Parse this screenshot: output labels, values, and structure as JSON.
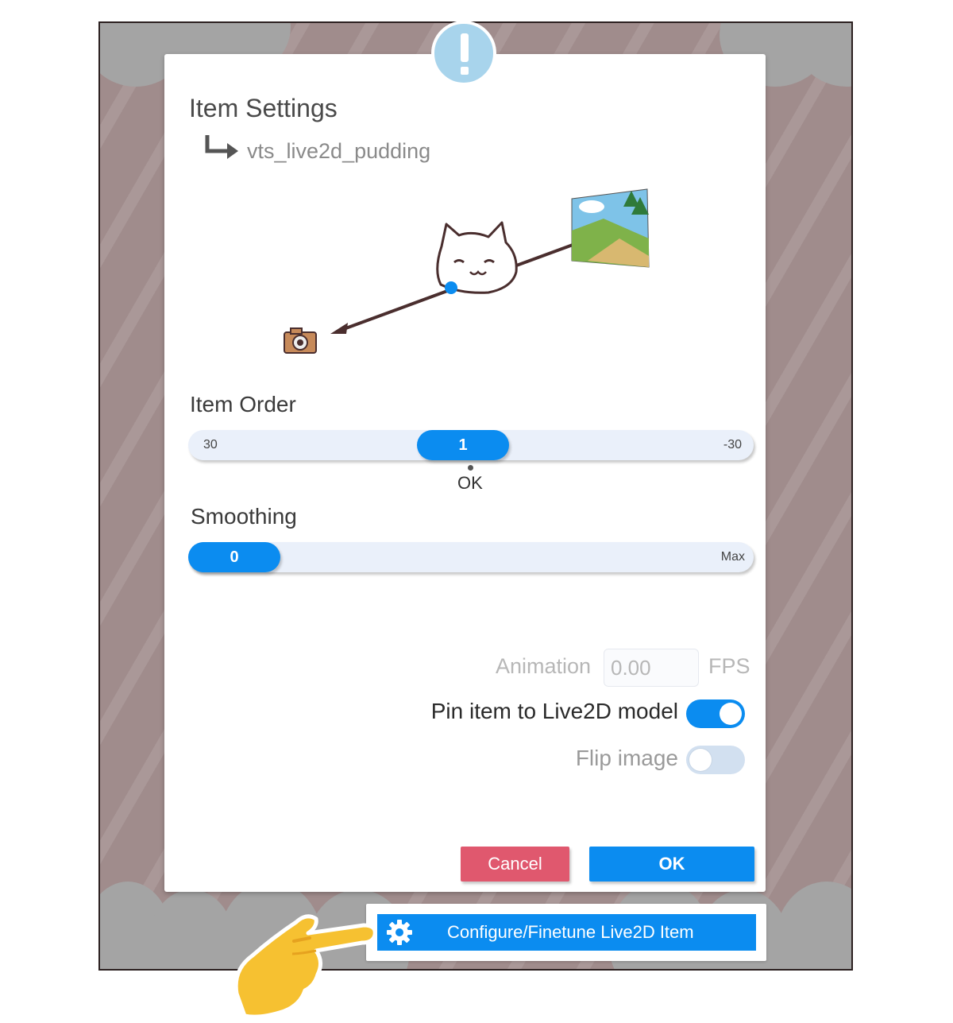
{
  "dialog": {
    "title": "Item Settings",
    "item_name": "vts_live2d_pudding"
  },
  "icons": {
    "alert": "exclamation-icon",
    "subitem_arrow": "return-arrow-icon",
    "cat": "cat-face-icon",
    "camera": "camera-icon",
    "landscape": "landscape-picture-icon",
    "gear": "gear-icon",
    "hand": "pointing-hand-icon"
  },
  "item_order": {
    "label": "Item Order",
    "min_label": "30",
    "max_label": "-30",
    "value": "1",
    "position_fraction": 0.48,
    "tick_label": "OK"
  },
  "smoothing": {
    "label": "Smoothing",
    "value": "0",
    "max_label": "Max",
    "position_fraction": 0.0
  },
  "animation": {
    "label": "Animation",
    "value": "0.00",
    "unit": "FPS"
  },
  "pin_toggle": {
    "label": "Pin item to Live2D model",
    "on": true
  },
  "flip_toggle": {
    "label": "Flip image",
    "on": false
  },
  "buttons": {
    "cancel": "Cancel",
    "ok": "OK",
    "configure": "Configure/Finetune Live2D Item"
  },
  "colors": {
    "accent": "#0b8cf0",
    "cancel": "#e0586e",
    "alert_badge": "#a8d4ec",
    "toggle_off": "#d2e0f0",
    "background": "#a08c8c"
  }
}
